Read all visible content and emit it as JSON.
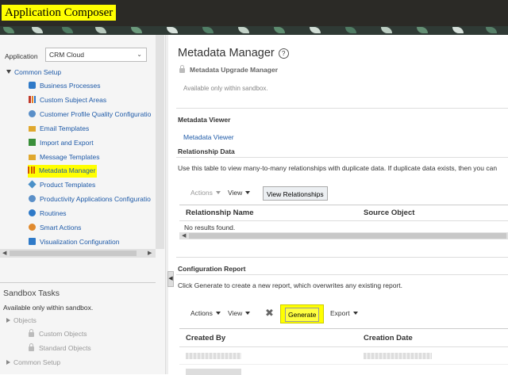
{
  "app": {
    "title": "Application Composer"
  },
  "sidebar": {
    "application_label": "Application",
    "application_value": "CRM Cloud",
    "common_setup": "Common Setup",
    "items": [
      {
        "label": "Business Processes",
        "icon": "business-processes-icon",
        "color": "#2f7ac8"
      },
      {
        "label": "Custom Subject Areas",
        "icon": "bar-chart-icon",
        "color": "#c0392b"
      },
      {
        "label": "Customer Profile Quality Configuratio",
        "icon": "gear-people-icon",
        "color": "#5a8fc8"
      },
      {
        "label": "Email Templates",
        "icon": "email-icon",
        "color": "#e0a82e"
      },
      {
        "label": "Import and Export",
        "icon": "import-export-icon",
        "color": "#3a8f3a"
      },
      {
        "label": "Message Templates",
        "icon": "message-icon",
        "color": "#e0a82e"
      },
      {
        "label": "Metadata Manager",
        "icon": "metadata-icon",
        "color": "#d35400",
        "selected": true
      },
      {
        "label": "Product Templates",
        "icon": "product-icon",
        "color": "#4a90c8"
      },
      {
        "label": "Productivity Applications Configuratio",
        "icon": "productivity-icon",
        "color": "#5a8fc8"
      },
      {
        "label": "Routines",
        "icon": "routines-icon",
        "color": "#2f7ac8"
      },
      {
        "label": "Smart Actions",
        "icon": "smart-actions-icon",
        "color": "#e08a2e"
      },
      {
        "label": "Visualization Configuration",
        "icon": "visualization-icon",
        "color": "#2f7ac8"
      }
    ],
    "sandbox_title": "Sandbox Tasks",
    "sandbox_note": "Available only within sandbox.",
    "objects_label": "Objects",
    "custom_objects": "Custom Objects",
    "standard_objects": "Standard Objects",
    "common_setup_2": "Common Setup"
  },
  "main": {
    "title": "Metadata Manager",
    "upgrade_label": "Metadata Upgrade Manager",
    "available_note": "Available only within sandbox.",
    "metadata_viewer_heading": "Metadata Viewer",
    "metadata_viewer_link": "Metadata Viewer",
    "relationship_heading": "Relationship Data",
    "relationship_desc": "Use this table to view many-to-many relationships with duplicate data. If duplicate data exists, then you can",
    "actions_label": "Actions",
    "view_label": "View",
    "view_relationships_button": "View Relationships",
    "col_relationship_name": "Relationship Name",
    "col_source_object": "Source Object",
    "no_results": "No results found.",
    "config_heading": "Configuration Report",
    "config_desc": "Click Generate to create a new report, which overwrites any existing report.",
    "actions_label_2": "Actions",
    "view_label_2": "View",
    "generate_button": "Generate",
    "export_label": "Export",
    "col_created_by": "Created By",
    "col_creation_date": "Creation Date"
  }
}
